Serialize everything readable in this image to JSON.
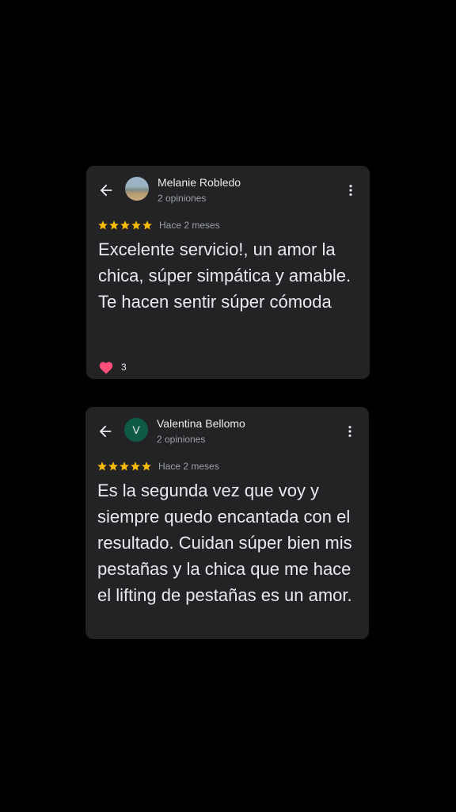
{
  "reviews": [
    {
      "reviewer_name": "Melanie Robledo",
      "opinions_count": "2 opiniones",
      "stars": 5,
      "time_ago": "Hace 2 meses",
      "text": "Excelente servicio!, un amor la chica, súper simpática y amable. Te hacen sentir súper cómoda",
      "reaction_count": "3",
      "avatar": "photo"
    },
    {
      "reviewer_name": "Valentina Bellomo",
      "opinions_count": "2 opiniones",
      "stars": 5,
      "time_ago": "Hace 2 meses",
      "text": "Es la segunda vez que voy y siempre quedo encantada con el resultado. Cuidan súper bien mis pestañas y la chica que me hace el lifting de pestañas es un amor.",
      "avatar_letter": "V",
      "avatar_color": "#0f5a45"
    }
  ],
  "icons": {
    "back": "arrow-left-icon",
    "more": "more-vertical-icon",
    "star": "star-icon",
    "heart": "heart-icon"
  },
  "colors": {
    "star": "#fbbc04",
    "heart": "#ff4f7b",
    "card": "#232326"
  }
}
